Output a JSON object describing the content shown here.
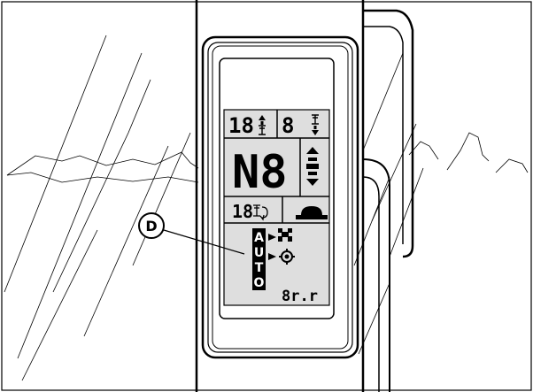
{
  "callout": {
    "label": "D"
  },
  "display": {
    "top_left_value": "18",
    "top_right_value": "8",
    "main_gear": "N8",
    "mid_left_value": "18",
    "auto_letters": [
      "A",
      "U",
      "T",
      "O"
    ],
    "bottom_value": "8r.r"
  },
  "icons": {
    "gear_up": "shift-up-icon",
    "gear_down": "shift-down-icon",
    "direction": "travel-direction-icon",
    "pto": "pto-speed-icon",
    "hood": "cab-hood-icon",
    "auto_shift": "tractor-shift-icon",
    "auto_pto": "pto-clutch-icon"
  }
}
